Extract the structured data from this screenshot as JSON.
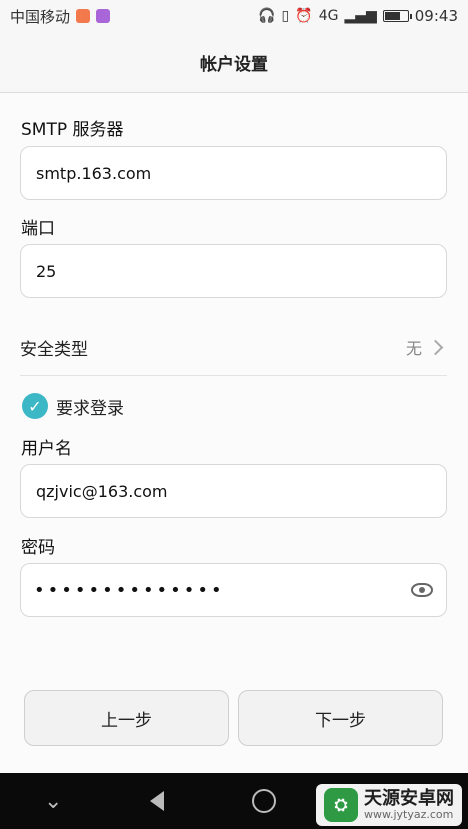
{
  "status_bar": {
    "carrier": "中国移动",
    "network": "4G",
    "time": "09:43"
  },
  "header": {
    "title": "帐户设置"
  },
  "smtp": {
    "label": "SMTP 服务器",
    "value": "smtp.163.com"
  },
  "port": {
    "label": "端口",
    "value": "25"
  },
  "security": {
    "label": "安全类型",
    "value": "无"
  },
  "login_required": {
    "label": "要求登录",
    "checked": true
  },
  "username": {
    "label": "用户名",
    "value": "qzjvic@163.com"
  },
  "password": {
    "label": "密码",
    "dots": "••••••••••••••"
  },
  "buttons": {
    "prev": "上一步",
    "next": "下一步"
  },
  "watermark": {
    "title": "天源安卓网",
    "url": "www.jytyaz.com"
  },
  "colors": {
    "accent": "#3bb7c6",
    "watermark_green": "#2e9b44"
  }
}
